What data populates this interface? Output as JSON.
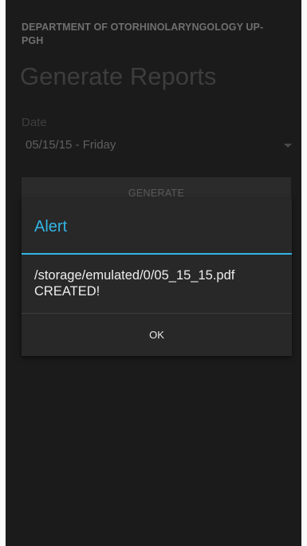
{
  "header": {
    "department": "DEPARTMENT OF OTORHINOLARYNGOLOGY UP-PGH",
    "title": "Generate Reports"
  },
  "form": {
    "date_label": "Date",
    "date_value": "05/15/15 - Friday",
    "generate_label": "GENERATE"
  },
  "dialog": {
    "title": "Alert",
    "message": "/storage/emulated/0/05_15_15.pdf CREATED!",
    "ok_label": "OK"
  },
  "colors": {
    "accent": "#33b5e5",
    "background": "#1b1b1b",
    "dialog_background": "#282828"
  }
}
